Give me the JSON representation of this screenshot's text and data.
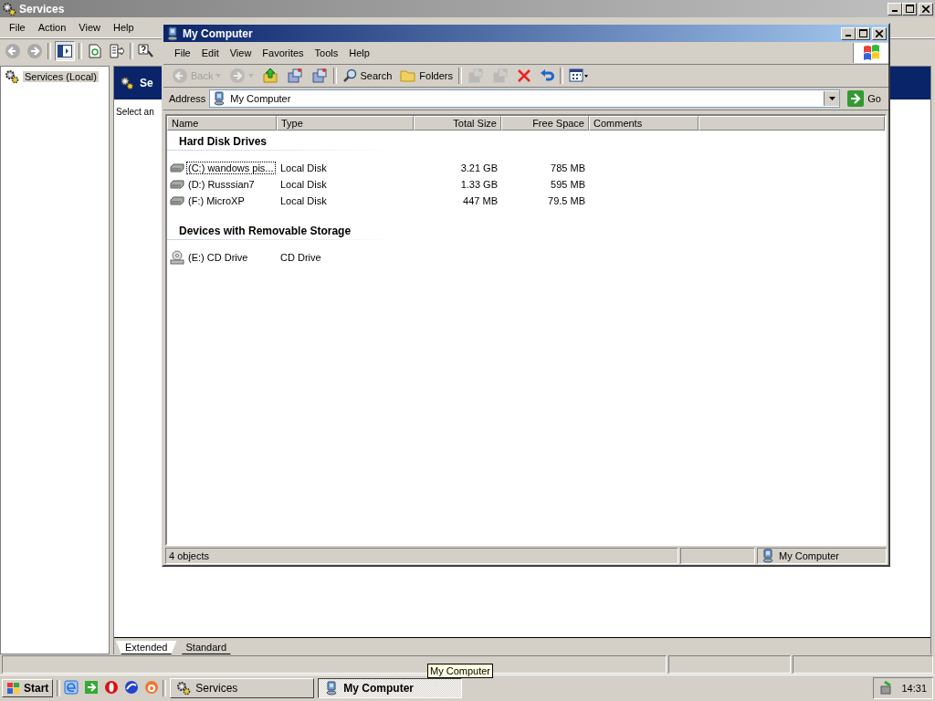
{
  "services_window": {
    "title": "Services",
    "menu": [
      {
        "label": "File"
      },
      {
        "label": "Action"
      },
      {
        "label": "View"
      },
      {
        "label": "Help"
      }
    ],
    "tree": [
      {
        "label": "Services (Local)",
        "selected": true
      }
    ],
    "header_title": "Se",
    "description": "Select an",
    "tabs": [
      {
        "label": "Extended",
        "selected": true
      },
      {
        "label": "Standard",
        "selected": false
      }
    ]
  },
  "explorer_window": {
    "title": "My Computer",
    "menu": [
      {
        "label": "File"
      },
      {
        "label": "Edit"
      },
      {
        "label": "View"
      },
      {
        "label": "Favorites"
      },
      {
        "label": "Tools"
      },
      {
        "label": "Help"
      }
    ],
    "toolbar": [
      {
        "kind": "back",
        "label": "Back",
        "disabled": true
      },
      {
        "kind": "forward",
        "disabled": true
      },
      {
        "kind": "up",
        "disabled": false
      },
      {
        "kind": "move",
        "disabled": false
      },
      {
        "kind": "copy",
        "disabled": false
      },
      {
        "kind": "sep"
      },
      {
        "kind": "search",
        "label": "Search",
        "disabled": false
      },
      {
        "kind": "folders",
        "label": "Folders",
        "disabled": false
      },
      {
        "kind": "sep"
      },
      {
        "kind": "moveto",
        "disabled": true
      },
      {
        "kind": "copyto",
        "disabled": true
      },
      {
        "kind": "delete",
        "disabled": false
      },
      {
        "kind": "undo",
        "disabled": false
      },
      {
        "kind": "sep"
      },
      {
        "kind": "views",
        "disabled": false
      }
    ],
    "address": {
      "label": "Address",
      "value": "My Computer",
      "go": "Go"
    },
    "columns": [
      {
        "label": "Name"
      },
      {
        "label": "Type"
      },
      {
        "label": "Total Size"
      },
      {
        "label": "Free Space"
      },
      {
        "label": "Comments"
      }
    ],
    "groups": [
      {
        "title": "Hard Disk Drives",
        "items": [
          {
            "kind": "hdd",
            "name": "(C:) wandows pis...",
            "type": "Local Disk",
            "total_size": "3.21 GB",
            "free_space": "785 MB",
            "selected": true
          },
          {
            "kind": "hdd",
            "name": "(D:) Russsian7",
            "type": "Local Disk",
            "total_size": "1.33 GB",
            "free_space": "595 MB",
            "selected": false
          },
          {
            "kind": "hdd",
            "name": "(F:) MicroXP",
            "type": "Local Disk",
            "total_size": "447 MB",
            "free_space": "79.5 MB",
            "selected": false
          }
        ]
      },
      {
        "title": "Devices with Removable Storage",
        "items": [
          {
            "kind": "cd",
            "name": "(E:) CD Drive",
            "type": "CD Drive",
            "selected": false
          }
        ]
      }
    ],
    "status": {
      "count": "4 objects",
      "zone": "My Computer"
    }
  },
  "taskbar": {
    "start": "Start",
    "buttons": [
      {
        "kind": "services",
        "label": "Services",
        "selected": false
      },
      {
        "kind": "computer",
        "label": "My Computer",
        "selected": true
      }
    ],
    "clock": "14:31"
  },
  "tooltip": "My Computer"
}
